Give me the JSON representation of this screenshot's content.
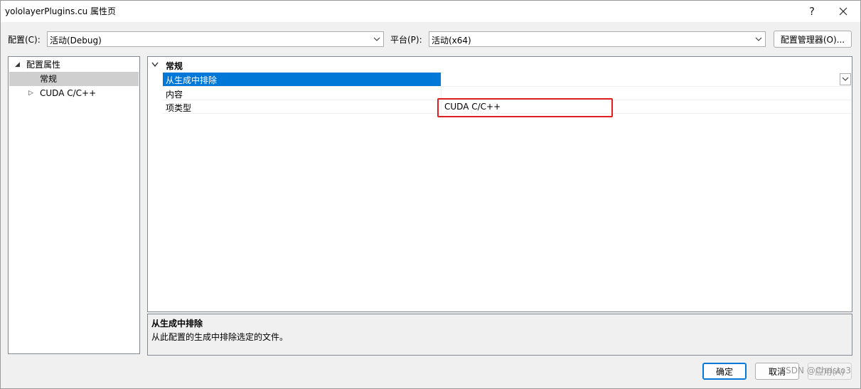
{
  "window": {
    "title": "yololayerPlugins.cu 属性页",
    "help_glyph": "?",
    "close_glyph": "✕"
  },
  "config_row": {
    "config_label": "配置(C):",
    "config_value": "活动(Debug)",
    "platform_label": "平台(P):",
    "platform_value": "活动(x64)",
    "config_manager_button": "配置管理器(O)..."
  },
  "tree": {
    "items": [
      {
        "label": "配置属性",
        "expander": "◢"
      },
      {
        "label": "常规"
      },
      {
        "label": "CUDA C/C++",
        "expander": "▷"
      }
    ]
  },
  "property_grid": {
    "category": {
      "label": "常规",
      "expander": "⌄"
    },
    "rows": [
      {
        "name": "从生成中排除",
        "value": ""
      },
      {
        "name": "内容",
        "value": ""
      },
      {
        "name": "项类型",
        "value": "CUDA C/C++"
      }
    ]
  },
  "description": {
    "title": "从生成中排除",
    "text": "从此配置的生成中排除选定的文件。"
  },
  "buttons": {
    "ok": "确定",
    "cancel": "取消",
    "apply": "应用(A)"
  },
  "watermark": "CSDN @Christo3",
  "colors": {
    "selection": "#0078d7",
    "highlight_box": "#e02020",
    "default_button_border": "#0078d7"
  }
}
